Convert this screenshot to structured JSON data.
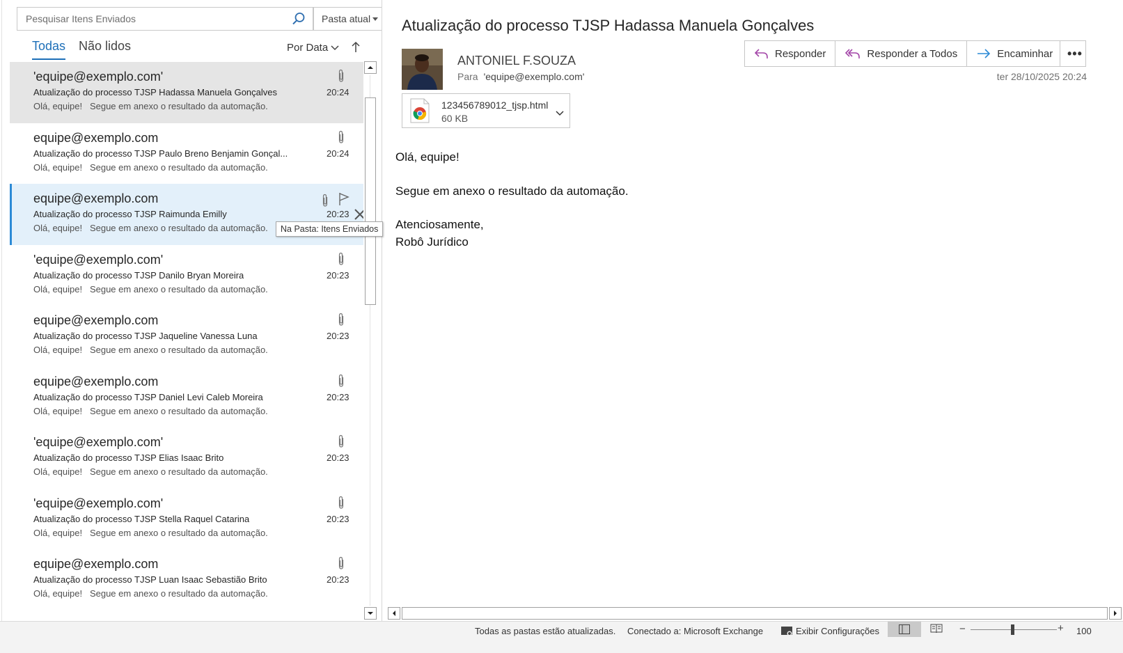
{
  "search": {
    "placeholder": "Pesquisar Itens Enviados",
    "scope": "Pasta atual"
  },
  "tabs": [
    {
      "label": "Todas",
      "active": true
    },
    {
      "label": "Não lidos",
      "active": false
    }
  ],
  "sort": {
    "label": "Por Data",
    "direction_icon": "arrow-up-icon"
  },
  "messages": [
    {
      "from": "'equipe@exemplo.com'",
      "subject": "Atualização do processo TJSP Hadassa Manuela Gonçalves",
      "preview": "Olá, equipe!   Segue em anexo o resultado da automação.",
      "time": "20:24",
      "attachment": true,
      "state": "selected-gray"
    },
    {
      "from": "equipe@exemplo.com",
      "subject": "Atualização do processo TJSP Paulo Breno Benjamin Gonçal...",
      "preview": "Olá, equipe!   Segue em anexo o resultado da automação.",
      "time": "20:24",
      "attachment": true,
      "state": "normal"
    },
    {
      "from": "equipe@exemplo.com",
      "subject": "Atualização do processo TJSP Raimunda Emilly",
      "preview": "Olá, equipe!   Segue em anexo o resultado da automação.",
      "time": "20:23",
      "attachment": true,
      "state": "hover"
    },
    {
      "from": "'equipe@exemplo.com'",
      "subject": "Atualização do processo TJSP Danilo Bryan Moreira",
      "preview": "Olá, equipe!   Segue em anexo o resultado da automação.",
      "time": "20:23",
      "attachment": true,
      "state": "normal"
    },
    {
      "from": "equipe@exemplo.com",
      "subject": "Atualização do processo TJSP Jaqueline Vanessa Luna",
      "preview": "Olá, equipe!   Segue em anexo o resultado da automação.",
      "time": "20:23",
      "attachment": true,
      "state": "normal"
    },
    {
      "from": "equipe@exemplo.com",
      "subject": "Atualização do processo TJSP Daniel Levi Caleb Moreira",
      "preview": "Olá, equipe!   Segue em anexo o resultado da automação.",
      "time": "20:23",
      "attachment": true,
      "state": "normal"
    },
    {
      "from": "'equipe@exemplo.com'",
      "subject": "Atualização do processo TJSP Elias Isaac Brito",
      "preview": "Olá, equipe!   Segue em anexo o resultado da automação.",
      "time": "20:23",
      "attachment": true,
      "state": "normal"
    },
    {
      "from": "'equipe@exemplo.com'",
      "subject": "Atualização do processo TJSP Stella Raquel Catarina",
      "preview": "Olá, equipe!   Segue em anexo o resultado da automação.",
      "time": "20:23",
      "attachment": true,
      "state": "normal"
    },
    {
      "from": "equipe@exemplo.com",
      "subject": "Atualização do processo TJSP Luan Isaac Sebastião Brito",
      "preview": "Olá, equipe!   Segue em anexo o resultado da automação.",
      "time": "20:23",
      "attachment": true,
      "state": "normal"
    }
  ],
  "tooltip": "Na Pasta: Itens Enviados",
  "reading": {
    "subject": "Atualização do processo TJSP Hadassa Manuela Gonçalves",
    "sender": "ANTONIEL F.SOUZA",
    "to_label": "Para",
    "to_value": "'equipe@exemplo.com'",
    "date": "ter 28/10/2025 20:24",
    "actions": {
      "reply": "Responder",
      "reply_all": "Responder a Todos",
      "forward": "Encaminhar",
      "more": "•••"
    },
    "attachment": {
      "filename": "123456789012_tjsp.html",
      "size": "60 KB"
    },
    "body": {
      "greeting": "Olá, equipe!",
      "line1": "Segue em anexo o resultado da automação.",
      "closing": "Atenciosamente,",
      "signature": "Robô Jurídico"
    }
  },
  "status": {
    "sync": "Todas as pastas estão atualizadas.",
    "connection": "Conectado a: Microsoft Exchange",
    "settings": "Exibir Configurações",
    "zoom": "100"
  },
  "colors": {
    "accent": "#1d6fb8",
    "action_purple": "#a346a8",
    "forward_blue": "#2c8ad6",
    "selected_gray": "#e5e5e5",
    "hover_blue": "#e3f0fa"
  }
}
